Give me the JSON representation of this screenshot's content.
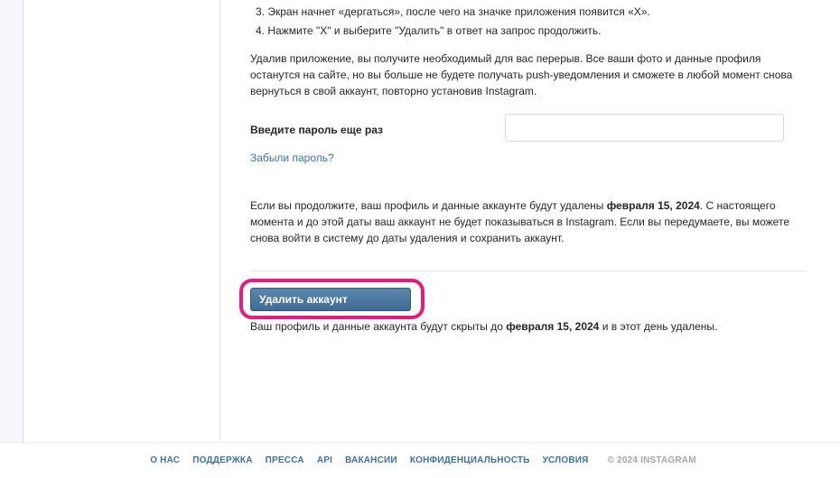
{
  "steps": [
    "3. Экран начнет «дергаться», после чего на значке приложения появится «Х».",
    "4. Нажмите \"X\" и выберите \"Удалить\" в ответ на запрос продолжить."
  ],
  "remove_info": "Удалив приложение, вы получите необходимый для вас перерыв. Все ваши фото и данные профиля останутся на сайте, но вы больше не будете получать push-уведомления и сможете в любой момент снова вернуться в свой аккаунт, повторно установив Instagram.",
  "password": {
    "label": "Введите пароль еще раз",
    "value": "",
    "placeholder": ""
  },
  "forgot_password": "Забыли пароль?",
  "warning": {
    "before": "Если вы продолжите, ваш профиль и данные аккаунте будут удалены ",
    "date": "февраля 15, 2024",
    "after": ". С настоящего момента и до этой даты ваш аккаунт не будет показываться в Instagram. Если вы передумаете, вы можете снова войти в систему до даты удаления и сохранить аккаунт."
  },
  "delete_button": "Удалить аккаунт",
  "after_note": {
    "before": "Ваш профиль и данные аккаунта будут скрыты до ",
    "date": "февраля 15, 2024",
    "after": " и в этот день удалены."
  },
  "footer": {
    "links": [
      "О НАС",
      "ПОДДЕРЖКА",
      "ПРЕССА",
      "API",
      "ВАКАНСИИ",
      "КОНФИДЕНЦИАЛЬНОСТЬ",
      "УСЛОВИЯ"
    ],
    "copyright": "© 2024 INSTAGRAM"
  },
  "colors": {
    "link": "#3f729b",
    "button": "#4a77a0",
    "highlight": "#e8197f",
    "text": "#262626"
  }
}
